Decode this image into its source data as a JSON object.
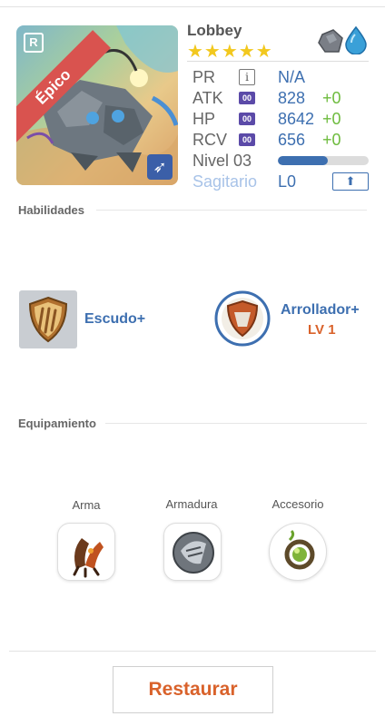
{
  "monster": {
    "name": "Lobbey",
    "stars": "★★★★★",
    "rarity": "Épico",
    "rarity_badge": "R",
    "sign_icon": "sagittarius-arrow-icon",
    "elements": [
      "rock-icon",
      "water-drop-icon"
    ]
  },
  "stats": {
    "pr": {
      "label": "PR",
      "badge": "i",
      "value": "N/A"
    },
    "atk": {
      "label": "ATK",
      "badge": "00",
      "value": "828",
      "bonus": "+0"
    },
    "hp": {
      "label": "HP",
      "badge": "00",
      "value": "8642",
      "bonus": "+0"
    },
    "rcv": {
      "label": "RCV",
      "badge": "00",
      "value": "656",
      "bonus": "+0"
    },
    "level": {
      "label": "Nivel 03",
      "progress": 0.55
    },
    "sign": {
      "label": "Sagitario",
      "value": "L0",
      "upgrade_icon": "upgrade-arrow-icon"
    }
  },
  "skills": {
    "title": "Habilidades",
    "items": [
      {
        "name": "Escudo+",
        "icon": "shield-icon"
      },
      {
        "name": "Arrollador+",
        "level": "LV 1",
        "icon": "charge-icon"
      }
    ]
  },
  "equipment": {
    "title": "Equipamiento",
    "slots": [
      {
        "label": "Arma",
        "icon": "weapon-claw-icon"
      },
      {
        "label": "Armadura",
        "icon": "armor-icon"
      },
      {
        "label": "Accesorio",
        "icon": "accessory-icon"
      }
    ]
  },
  "actions": {
    "restore_label": "Restaurar"
  },
  "colors": {
    "accent_blue": "#3d6fb0",
    "bonus_green": "#6dbb3d",
    "accent_orange": "#d9622b",
    "ribbon_red": "#d9534f",
    "star_gold": "#f2c81e"
  }
}
